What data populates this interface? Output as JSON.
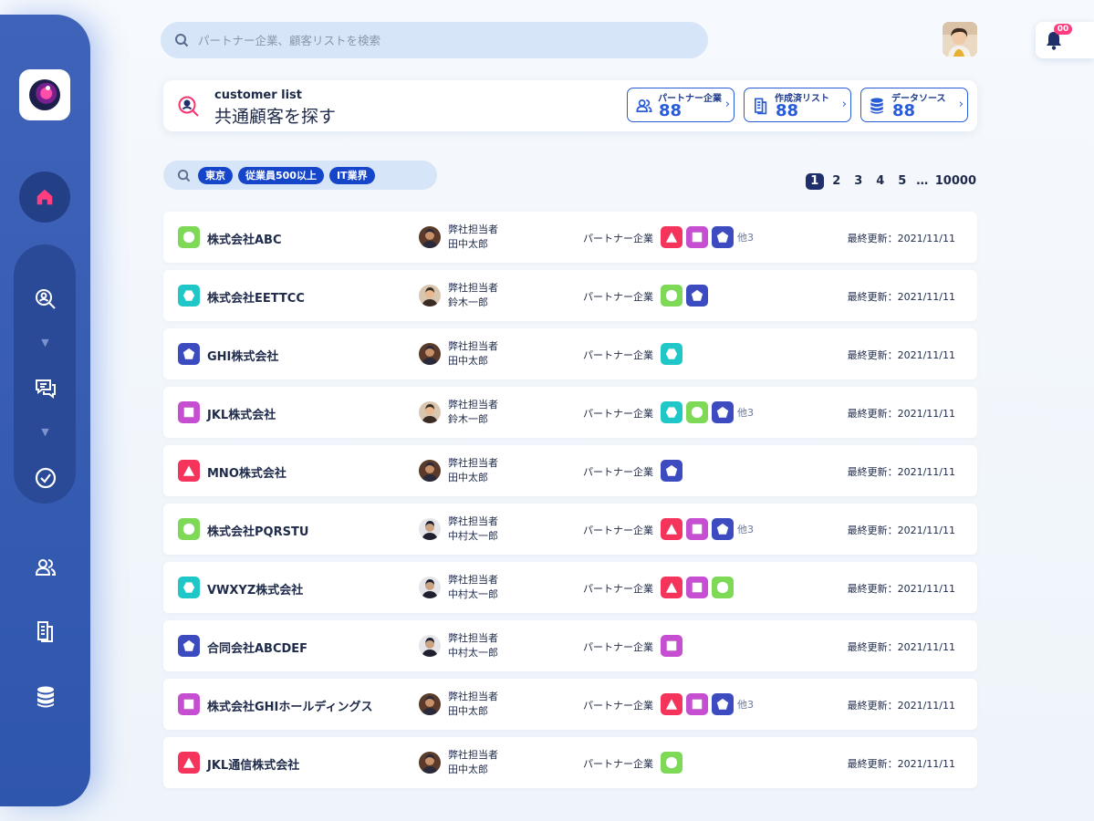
{
  "search": {
    "placeholder": "パートナー企業、顧客リストを検索"
  },
  "notifications": {
    "count": "00"
  },
  "header": {
    "title_en": "customer list",
    "title_ja": "共通顧客を探す",
    "stats": [
      {
        "label": "パートナー企業",
        "value": "88",
        "icon": "users-icon"
      },
      {
        "label": "作成済リスト",
        "value": "88",
        "icon": "document-icon"
      },
      {
        "label": "データソース",
        "value": "88",
        "icon": "database-icon"
      }
    ]
  },
  "filters": {
    "chips": [
      "東京",
      "従業員500以上",
      "IT業界"
    ]
  },
  "pagination": {
    "pages": [
      "1",
      "2",
      "3",
      "4",
      "5"
    ],
    "ellipsis": "…",
    "last": "10000",
    "current": "1"
  },
  "colors": {
    "sidebar": "#3f63b8",
    "accent": "#2a5bd7",
    "green": "#7ed957",
    "cyan": "#1fc7c7",
    "indigo": "#3c4bbf",
    "purple": "#c64fd1",
    "red": "#f4345b"
  },
  "rows": [
    {
      "company": "株式会社ABC",
      "icon": "circle",
      "color": "green",
      "rep_title": "弊社担当者",
      "rep_name": "田中太郎",
      "partner_label": "パートナー企業",
      "partners": [
        "triangle",
        "square",
        "pentagon"
      ],
      "more": "他3",
      "updated": "最終更新：2021/11/11"
    },
    {
      "company": "株式会社EETTCC",
      "icon": "hexagon",
      "color": "cyan",
      "rep_title": "弊社担当者",
      "rep_name": "鈴木一郎",
      "partner_label": "パートナー企業",
      "partners": [
        "circle",
        "pentagon"
      ],
      "more": "",
      "updated": "最終更新：2021/11/11"
    },
    {
      "company": "GHI株式会社",
      "icon": "pentagon",
      "color": "indigo",
      "rep_title": "弊社担当者",
      "rep_name": "田中太郎",
      "partner_label": "パートナー企業",
      "partners": [
        "hexagon"
      ],
      "more": "",
      "updated": "最終更新：2021/11/11"
    },
    {
      "company": "JKL株式会社",
      "icon": "square",
      "color": "purple",
      "rep_title": "弊社担当者",
      "rep_name": "鈴木一郎",
      "partner_label": "パートナー企業",
      "partners": [
        "hexagon",
        "circle",
        "pentagon"
      ],
      "more": "他3",
      "updated": "最終更新：2021/11/11"
    },
    {
      "company": "MNO株式会社",
      "icon": "triangle",
      "color": "red",
      "rep_title": "弊社担当者",
      "rep_name": "田中太郎",
      "partner_label": "パートナー企業",
      "partners": [
        "pentagon"
      ],
      "more": "",
      "updated": "最終更新：2021/11/11"
    },
    {
      "company": "株式会社PQRSTU",
      "icon": "circle",
      "color": "green",
      "rep_title": "弊社担当者",
      "rep_name": "中村太一郎",
      "partner_label": "パートナー企業",
      "partners": [
        "triangle",
        "square",
        "pentagon"
      ],
      "more": "他3",
      "updated": "最終更新：2021/11/11"
    },
    {
      "company": "VWXYZ株式会社",
      "icon": "hexagon",
      "color": "cyan",
      "rep_title": "弊社担当者",
      "rep_name": "中村太一郎",
      "partner_label": "パートナー企業",
      "partners": [
        "triangle",
        "square",
        "circle"
      ],
      "more": "",
      "updated": "最終更新：2021/11/11"
    },
    {
      "company": "合同会社ABCDEF",
      "icon": "pentagon",
      "color": "indigo",
      "rep_title": "弊社担当者",
      "rep_name": "中村太一郎",
      "partner_label": "パートナー企業",
      "partners": [
        "square"
      ],
      "more": "",
      "updated": "最終更新：2021/11/11"
    },
    {
      "company": "株式会社GHIホールディングス",
      "icon": "square",
      "color": "purple",
      "rep_title": "弊社担当者",
      "rep_name": "田中太郎",
      "partner_label": "パートナー企業",
      "partners": [
        "triangle",
        "square",
        "pentagon"
      ],
      "more": "他3",
      "updated": "最終更新：2021/11/11"
    },
    {
      "company": "JKL通信株式会社",
      "icon": "triangle",
      "color": "red",
      "rep_title": "弊社担当者",
      "rep_name": "田中太郎",
      "partner_label": "パートナー企業",
      "partners": [
        "circle"
      ],
      "more": "",
      "updated": "最終更新：2021/11/11"
    }
  ]
}
